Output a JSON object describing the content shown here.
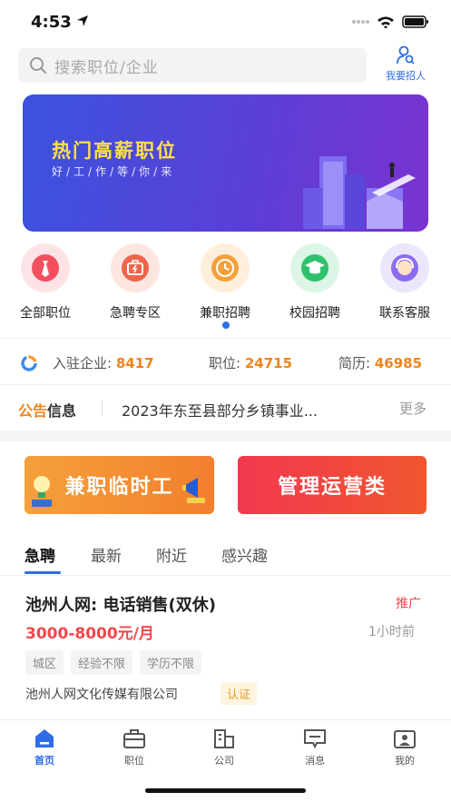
{
  "status_bar": {
    "time": "4:53"
  },
  "search": {
    "placeholder": "搜索职位/企业",
    "recruit_label": "我要招人"
  },
  "banner": {
    "title": "热门高薪职位",
    "subtitle": "好/工/作/等/你/来"
  },
  "categories": [
    {
      "label": "全部职位",
      "icon": "tie-icon",
      "color": "#f3505f"
    },
    {
      "label": "急聘专区",
      "icon": "briefcase-bolt-icon",
      "color": "#f0644a"
    },
    {
      "label": "兼职招聘",
      "icon": "clock-icon",
      "color": "#f5a03a"
    },
    {
      "label": "校园招聘",
      "icon": "graduation-cap-icon",
      "color": "#2ec26c"
    },
    {
      "label": "联系客服",
      "icon": "support-agent-icon",
      "color": "#8b6cf0"
    }
  ],
  "stats": {
    "companies_label": "入驻企业:",
    "companies": "8417",
    "jobs_label": "职位:",
    "jobs": "24715",
    "resumes_label": "简历:",
    "resumes": "46985"
  },
  "notice": {
    "logo_a": "公告",
    "logo_b": "信息",
    "text": "2023年东至县部分乡镇事业...",
    "more": "更多"
  },
  "promos": {
    "left": "兼职临时工",
    "right": "管理运营类"
  },
  "tabs": [
    "急聘",
    "最新",
    "附近",
    "感兴趣"
  ],
  "job": {
    "title": "池州人网: 电话销售(双休)",
    "promo_tag": "推广",
    "salary": "3000-8000元/月",
    "time": "1小时前",
    "tags": [
      "城区",
      "经验不限",
      "学历不限"
    ],
    "company": "池州人网文化传媒有限公司",
    "cert": "认证"
  },
  "tabbar": [
    {
      "label": "首页",
      "icon": "home-icon",
      "active": true
    },
    {
      "label": "职位",
      "icon": "briefcase-icon",
      "active": false
    },
    {
      "label": "公司",
      "icon": "building-icon",
      "active": false
    },
    {
      "label": "消息",
      "icon": "message-icon",
      "active": false
    },
    {
      "label": "我的",
      "icon": "profile-icon",
      "active": false
    }
  ],
  "colors": {
    "accent": "#2f6ce8",
    "orange": "#f0841a",
    "red": "#f0484a"
  }
}
